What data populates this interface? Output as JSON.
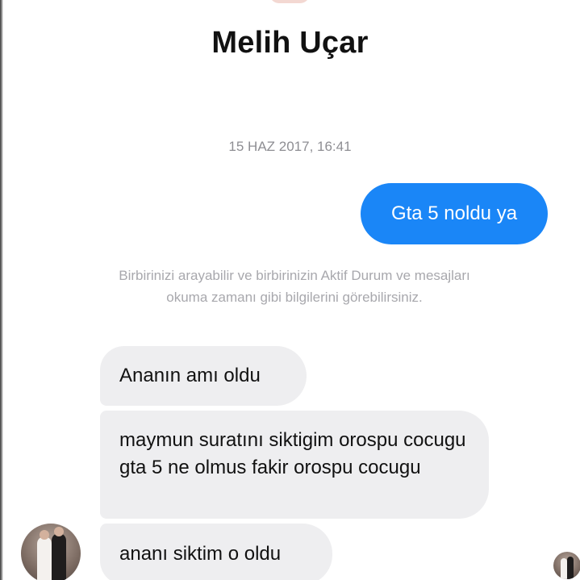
{
  "header": {
    "contact_name": "Melih Uçar"
  },
  "conversation": {
    "timestamp": "15 HAZ 2017, 16:41",
    "outgoing": [
      {
        "text": "Gta 5 noldu ya"
      }
    ],
    "notice": "Birbirinizi arayabilir ve birbirinizin Aktif Durum ve mesajları okuma zamanı gibi bilgilerini görebilirsiniz.",
    "incoming": [
      {
        "text": "Ananın amı oldu"
      },
      {
        "text": "maymun suratını siktigim orospu cocugu gta 5 ne olmus fakir orospu cocugu"
      },
      {
        "text": "ananı siktim o oldu"
      }
    ]
  },
  "colors": {
    "outgoing_bubble": "#1a86f7",
    "incoming_bubble": "#eeeef0",
    "timestamp_text": "#8e8e93",
    "notice_text": "#a8a8ad"
  },
  "icons": {
    "sender_avatar": "contact-avatar-photo",
    "read_receipt": "read-receipt-avatar"
  }
}
